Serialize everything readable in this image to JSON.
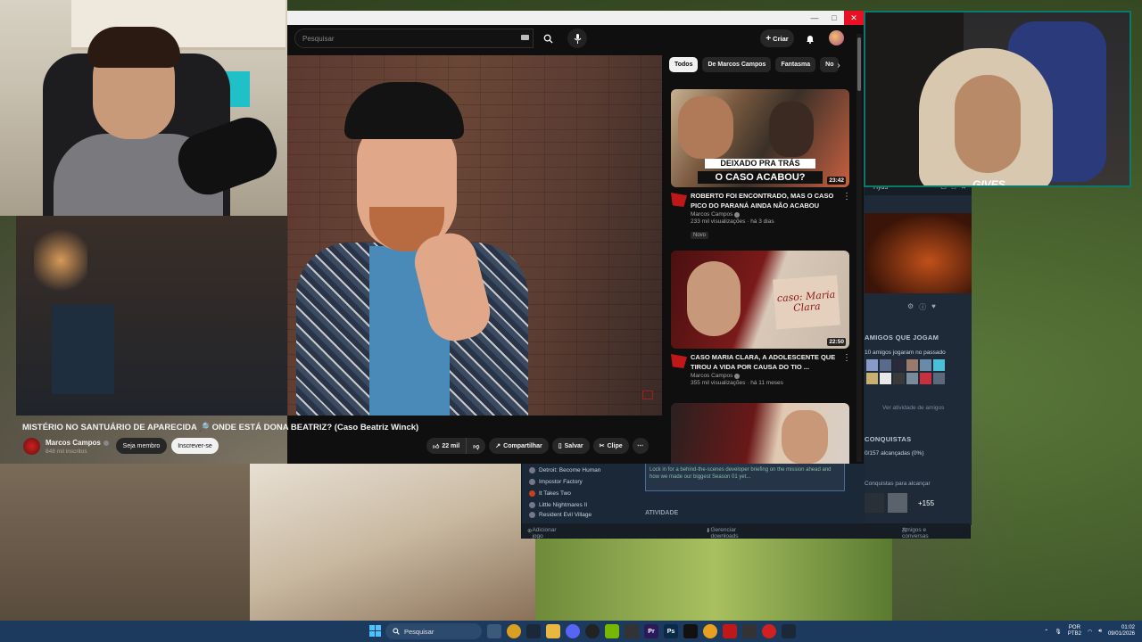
{
  "youtube": {
    "search_placeholder": "Pesquisar",
    "create_label": "Criar",
    "chips": [
      "Todos",
      "De Marcos Campos",
      "Fantasma",
      "No"
    ],
    "video": {
      "title": "MISTÉRIO NO SANTUÁRIO DE APARECIDA 🔎 ONDE ESTÁ DONA BEATRIZ? (Caso Beatriz Winck)",
      "channel": "Marcos Campos",
      "subscribers": "848 mil inscritos",
      "member_label": "Seja membro",
      "subscribe_label": "Inscrever-se",
      "likes": "22 mil",
      "share_label": "Compartilhar",
      "save_label": "Salvar",
      "clip_label": "Clipe"
    },
    "recommendations": [
      {
        "thumb_caption_top": "DEIXADO PRA TRÁS",
        "thumb_caption_bottom": "O CASO ACABOU?",
        "duration": "23:42",
        "title": "ROBERTO FOI ENCONTRADO, MAS O CASO PICO DO PARANÁ AINDA NÃO ACABOU",
        "channel": "Marcos Campos",
        "meta": "233 mil visualizações · há 3 dias",
        "badge": "Novo"
      },
      {
        "thumb_script": "caso: Maria Clara",
        "duration": "22:50",
        "title": "CASO MARIA CLARA, A ADOLESCENTE QUE TIROU A VIDA POR CAUSA DO TIO ...",
        "channel": "Marcos Campos",
        "meta": "355 mil visualizações · há 11 meses"
      }
    ]
  },
  "steam": {
    "user": "Hyd3",
    "friends_playing_title": "AMIGOS QUE JOGAM",
    "friends_played_text": "10 amigos jogaram no passado",
    "friends_activity_link": "Ver atividade de amigos",
    "achievements_title": "CONQUISTAS",
    "achievements_progress": "0/157 alcançadas (0%)",
    "achievements_reach_label": "Conquistas para alcançar",
    "achievements_more": "+155",
    "library": [
      "Detroit: Become Human",
      "Impostor Factory",
      "It Takes Two",
      "Little Nightmares II",
      "Resident Evil Village"
    ],
    "news_text": "Lock in for a behind-the-scenes developer briefing on the mission ahead and how we made our biggest Season 01 yet...",
    "activity_title": "ATIVIDADE",
    "add_game": "Adicionar jogo",
    "downloads": "Gerenciar downloads",
    "friends_chat": "Amigos e conversas"
  },
  "webcam_right": {
    "brand": "GIVES"
  },
  "taskbar": {
    "search_label": "Pesquisar",
    "lang_top": "POR",
    "lang_bottom": "PTB2",
    "time": "01:02",
    "date": "09/01/2026"
  },
  "colors": {
    "youtube_bg": "#0f0f0f",
    "steam_bg": "#1b2838",
    "taskbar_bg": "#1c3a5e",
    "close_red": "#e81123"
  }
}
